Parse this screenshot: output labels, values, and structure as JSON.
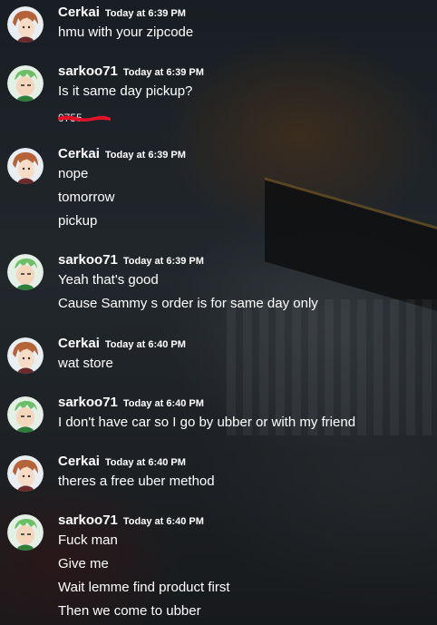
{
  "colors": {
    "text": "#ffffff",
    "redaction": "#e0132b"
  },
  "icons": {
    "cerkai_avatar": "avatar-cerkai-icon",
    "sarkoo_avatar": "avatar-sarkoo71-icon"
  },
  "messages": [
    {
      "user": "Cerkai",
      "time": "Today at 6:39 PM",
      "lines": [
        "hmu with your zipcode"
      ]
    },
    {
      "user": "sarkoo71",
      "time": "Today at 6:39 PM",
      "lines": [
        "Is it same day pickup?"
      ],
      "redacted_fragment": "0755"
    },
    {
      "user": "Cerkai",
      "time": "Today at 6:39 PM",
      "lines": [
        "nope",
        "tomorrow",
        "pickup"
      ]
    },
    {
      "user": "sarkoo71",
      "time": "Today at 6:39 PM",
      "lines": [
        "Yeah that's good",
        "Cause Sammy s order is for same day only"
      ]
    },
    {
      "user": "Cerkai",
      "time": "Today at 6:40 PM",
      "lines": [
        "wat store"
      ]
    },
    {
      "user": "sarkoo71",
      "time": "Today at 6:40 PM",
      "lines": [
        "I don't have car so I go by ubber or with my friend"
      ]
    },
    {
      "user": "Cerkai",
      "time": "Today at 6:40 PM",
      "lines": [
        "theres a free uber method"
      ]
    },
    {
      "user": "sarkoo71",
      "time": "Today at 6:40 PM",
      "lines": [
        "Fuck man",
        "Give me",
        "Wait lemme find product first",
        "Then we come to ubber"
      ]
    }
  ]
}
